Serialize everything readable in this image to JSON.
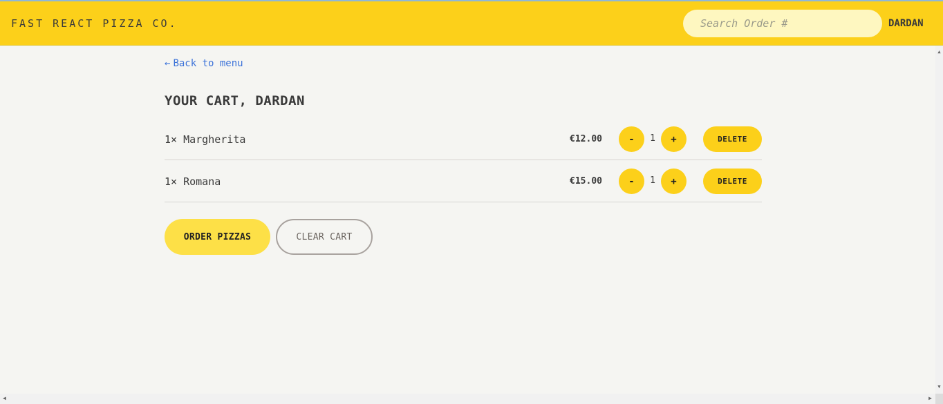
{
  "header": {
    "logo": "FAST REACT PIZZA CO.",
    "search_placeholder": "Search Order #",
    "search_value": "",
    "username": "DARDAN"
  },
  "nav": {
    "back_arrow": "←",
    "back_label": "Back to menu"
  },
  "cart": {
    "title": "YOUR CART, DARDAN",
    "items": [
      {
        "name": "1× Margherita",
        "price": "€12.00",
        "minus": "-",
        "quantity": "1",
        "plus": "+",
        "delete_label": "DELETE"
      },
      {
        "name": "1× Romana",
        "price": "€15.00",
        "minus": "-",
        "quantity": "1",
        "plus": "+",
        "delete_label": "DELETE"
      }
    ]
  },
  "actions": {
    "order_label": "ORDER PIZZAS",
    "clear_label": "CLEAR CART"
  },
  "scrollbars": {
    "up_icon": "▲",
    "down_icon": "▼",
    "left_icon": "◀",
    "right_icon": "▶"
  },
  "colors": {
    "header_bg": "#fcd01a",
    "accent": "#fcd01a",
    "link": "#3b72d9",
    "page_bg": "#f5f5f2"
  }
}
